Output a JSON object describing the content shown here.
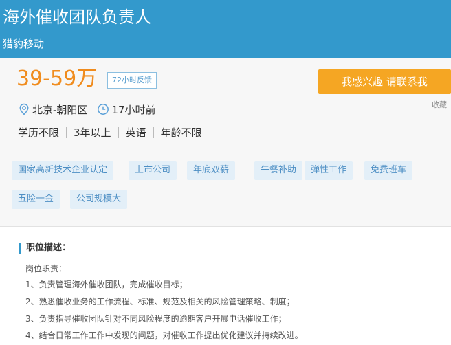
{
  "header": {
    "title": "海外催收团队负责人",
    "company": "猎豹移动",
    "bg_color": "#3399cc"
  },
  "info": {
    "salary": "39-59万",
    "feedback_badge": "72小时反馈",
    "apply_button": "我感兴趣 请联系我",
    "favorite_link": "收藏",
    "location_icon": "location-pin-icon",
    "location": "北京-朝阳区",
    "time_icon": "clock-icon",
    "posted": "17小时前",
    "requirements": [
      "学历不限",
      "3年以上",
      "英语",
      "年龄不限"
    ],
    "accent_color": "#f08c1e",
    "button_color": "#f5a623"
  },
  "tags": [
    "国家高新技术企业认定",
    "上市公司",
    "年底双薪",
    "午餐补助",
    "弹性工作",
    "免费班车",
    "五险一金",
    "公司规模大"
  ],
  "description": {
    "heading": "职位描述：",
    "lines": [
      "岗位职责：",
      "1、负责管理海外催收团队，完成催收目标；",
      "2、熟悉催收业务的工作流程、标准、规范及相关的风险管理策略、制度；",
      "3、负责指导催收团队针对不同风险程度的逾期客户开展电话催收工作；",
      "4、结合日常工作工作中发现的问题，对催收工作提出优化建议并持续改进。"
    ]
  }
}
